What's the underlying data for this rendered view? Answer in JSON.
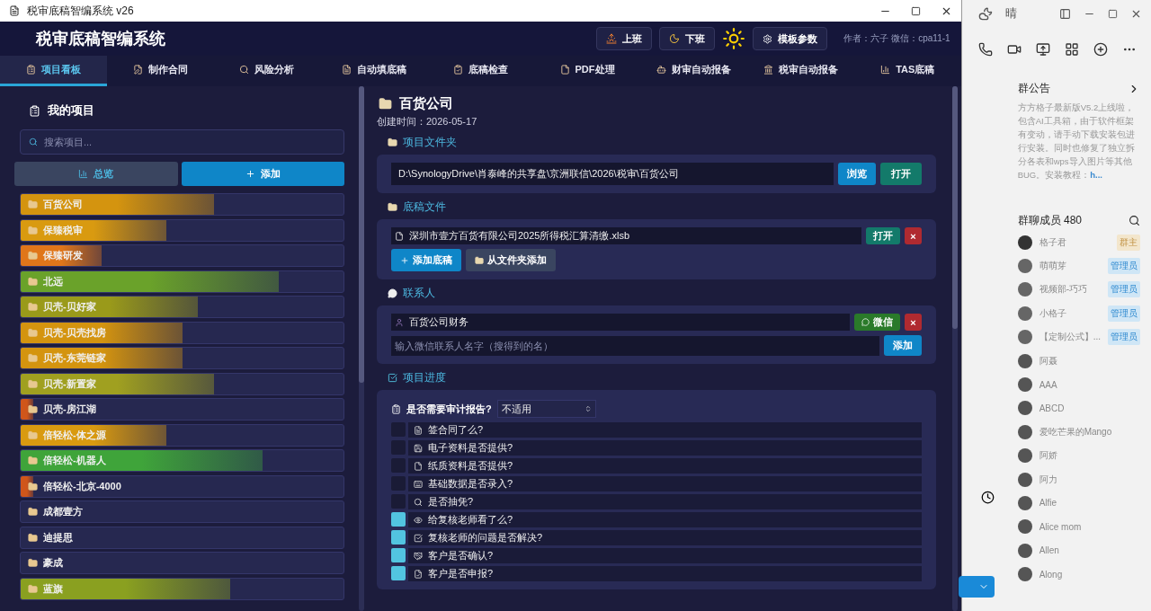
{
  "window": {
    "title": "税审底稿智编系统 v26"
  },
  "header": {
    "title": "税审底稿智编系统",
    "buttons": [
      {
        "label": "上班"
      },
      {
        "label": "下班"
      }
    ],
    "template_button": "模板参数",
    "author": "作者：六子  微信：cpa11-1"
  },
  "tabs": [
    {
      "label": "项目看板",
      "selected": true
    },
    {
      "label": "制作合同",
      "selected": false
    },
    {
      "label": "风险分析",
      "selected": false
    },
    {
      "label": "自动填底稿",
      "selected": false
    },
    {
      "label": "底稿检查",
      "selected": false
    },
    {
      "label": "PDF处理",
      "selected": false
    },
    {
      "label": "财审自动报备",
      "selected": false
    },
    {
      "label": "税审自动报备",
      "selected": false
    },
    {
      "label": "TAS底稿",
      "selected": false
    }
  ],
  "sidebar": {
    "title": "我的项目",
    "search": {
      "placeholder": "搜索项目..."
    },
    "overview_button": "总览",
    "add_button": "添加",
    "items": [
      {
        "name": "百货公司",
        "color": "#d4940f",
        "level": 0.6
      },
      {
        "name": "保臻税审",
        "color": "#d99a10",
        "level": 0.45
      },
      {
        "name": "保臻研发",
        "color": "#e0761a",
        "level": 0.25
      },
      {
        "name": "北远",
        "color": "#6aa22a",
        "level": 0.8
      },
      {
        "name": "贝壳-贝好家",
        "color": "#9a9a1a",
        "level": 0.55
      },
      {
        "name": "贝壳-贝壳找房",
        "color": "#d4940f",
        "level": 0.5
      },
      {
        "name": "贝壳-东莞链家",
        "color": "#d4940f",
        "level": 0.5
      },
      {
        "name": "贝壳-新置家",
        "color": "#a0a020",
        "level": 0.6
      },
      {
        "name": "贝壳-房江湖",
        "color": "#d0561a",
        "level": 0.04
      },
      {
        "name": "倍轻松-体之源",
        "color": "#d99a10",
        "level": 0.45
      },
      {
        "name": "倍轻松-机器人",
        "color": "#3fa43a",
        "level": 0.75
      },
      {
        "name": "倍轻松-北京-4000",
        "color": "#d0561a",
        "level": 0.04
      },
      {
        "name": "成都壹方"
      },
      {
        "name": "迪提思"
      },
      {
        "name": "豪成"
      },
      {
        "name": "蓝旗",
        "color": "#8aa020",
        "level": 0.65
      }
    ]
  },
  "project": {
    "title": "百货公司",
    "created": "创建时间：2026-05-17",
    "folder": {
      "heading": "项目文件夹",
      "path": "D:\\SynologyDrive\\肖泰峰的共享盘\\京洲联信\\2026\\税审\\百货公司",
      "browse": "浏览",
      "open": "打开"
    },
    "files": {
      "heading": "底稿文件",
      "items": [
        {
          "name": "深圳市壹方百货有限公司2025所得税汇算清缴.xlsb",
          "open": "打开",
          "remove": "×"
        }
      ],
      "add": "添加底稿",
      "add_from_folder": "从文件夹添加"
    },
    "contacts": {
      "heading": "联系人",
      "items": [
        {
          "name": "百货公司财务",
          "wechat": "微信",
          "remove": "×"
        }
      ],
      "placeholder": "输入微信联系人名字（搜得到的名）",
      "add": "添加"
    },
    "progress": {
      "heading": "项目进度",
      "question": "是否需要审计报告?",
      "answer": "不适用",
      "items": [
        {
          "label": "签合同了么?",
          "checked": false
        },
        {
          "label": "电子资料是否提供?",
          "checked": false
        },
        {
          "label": "纸质资料是否提供?",
          "checked": false
        },
        {
          "label": "基础数据是否录入?",
          "checked": false
        },
        {
          "label": "是否抽凭?",
          "checked": false
        },
        {
          "label": "给复核老师看了么?",
          "checked": true
        },
        {
          "label": "复核老师的问题是否解决?",
          "checked": true
        },
        {
          "label": "客户是否确认?",
          "checked": true
        },
        {
          "label": "客户是否申报?",
          "checked": true
        }
      ]
    }
  },
  "chat": {
    "weather": "晴",
    "announcement": {
      "title": "群公告",
      "text": "方方格子最新版V5.2上线啦，包含AI工具箱，由于软件框架有变动，请手动下载安装包进行安装。同时也修复了独立拆分各表和wps导入图片等其他BUG。安装教程：",
      "link": "h..."
    },
    "members": {
      "title": "群聊成员 480",
      "items": [
        {
          "name": "格子君",
          "badge": "群主",
          "kind": "owner"
        },
        {
          "name": "萌萌芽",
          "badge": "管理员",
          "kind": "admin"
        },
        {
          "name": "视频部-巧巧",
          "badge": "管理员",
          "kind": "admin"
        },
        {
          "name": "小格子",
          "badge": "管理员",
          "kind": "admin"
        },
        {
          "name": "【定制公式】...",
          "badge": "管理员",
          "kind": "admin"
        },
        {
          "name": "阿聂",
          "kind": "member"
        },
        {
          "name": "AAA",
          "kind": "member"
        },
        {
          "name": "ABCD",
          "kind": "member"
        },
        {
          "name": "爱吃芒果的Mango",
          "kind": "member"
        },
        {
          "name": "阿娇",
          "kind": "member"
        },
        {
          "name": "阿力",
          "kind": "member"
        },
        {
          "name": "Alfie",
          "kind": "member"
        },
        {
          "name": "Alice mom",
          "kind": "member"
        },
        {
          "name": "Allen",
          "kind": "member"
        },
        {
          "name": "Along",
          "kind": "member"
        }
      ]
    }
  }
}
